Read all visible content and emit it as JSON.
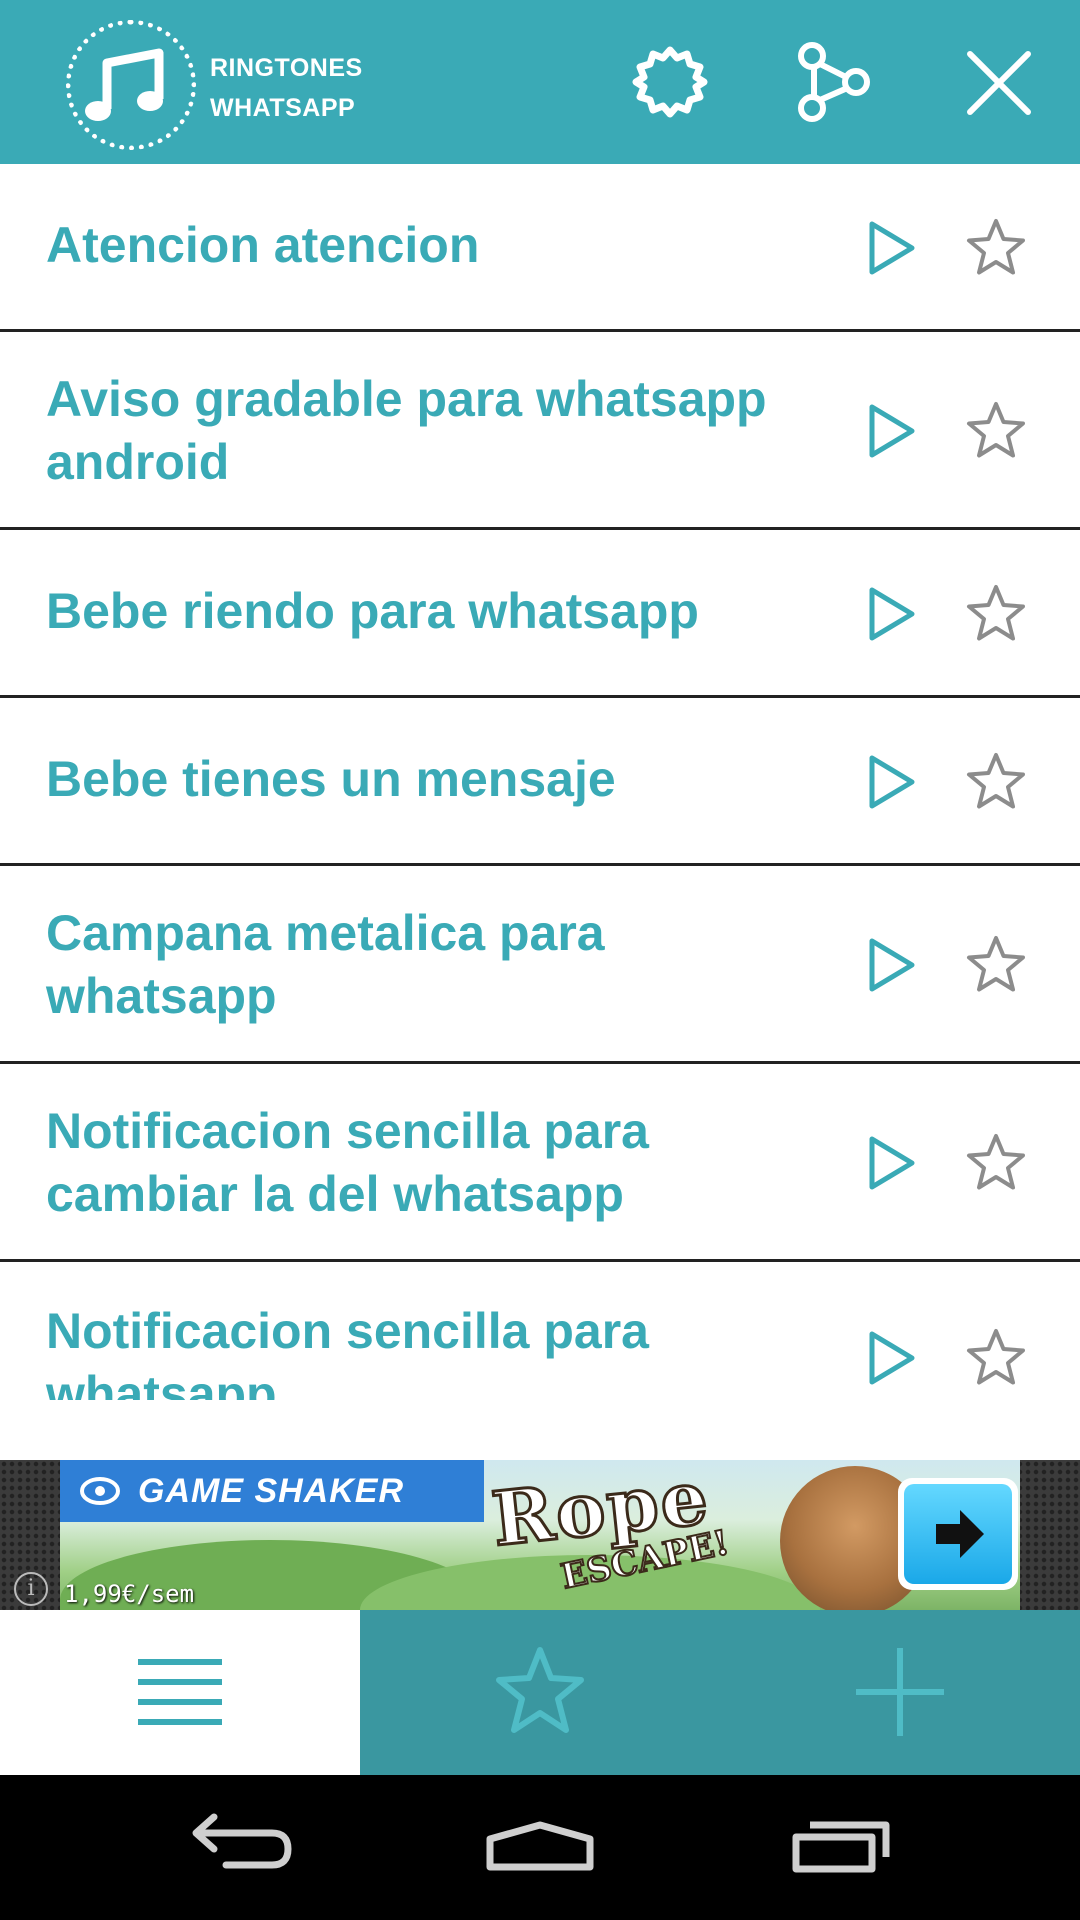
{
  "app": {
    "logo_line1": "RINGTONES",
    "logo_line2": "WHATSAPP",
    "accent_color": "#3aaab6",
    "tab_bar_color": "#3a97a0"
  },
  "header": {
    "icons": [
      "music-note-icon",
      "gear-icon",
      "share-icon",
      "close-icon"
    ]
  },
  "ringtones": [
    {
      "title": "Atencion atencion"
    },
    {
      "title": "Aviso gradable para whatsapp android"
    },
    {
      "title": "Bebe riendo para whatsapp"
    },
    {
      "title": "Bebe tienes un mensaje"
    },
    {
      "title": "Campana metalica para whatsapp"
    },
    {
      "title": "Notificacion sencilla para cambiar la del whatsapp"
    },
    {
      "title": "Notificacion sencilla para whatsapp"
    }
  ],
  "row_icons": [
    "play-icon",
    "star-outline-icon"
  ],
  "ad": {
    "brand": "GAME SHAKER",
    "title": "Rope",
    "subtitle": "ESCAPE!",
    "price": "1,99€/sem",
    "info": "i"
  },
  "tabs": [
    {
      "name": "list",
      "icon": "menu-icon",
      "selected": true
    },
    {
      "name": "favorites",
      "icon": "star-icon",
      "selected": false
    },
    {
      "name": "add",
      "icon": "plus-icon",
      "selected": false
    }
  ],
  "system_nav": [
    "back-icon",
    "home-icon",
    "recent-apps-icon"
  ]
}
